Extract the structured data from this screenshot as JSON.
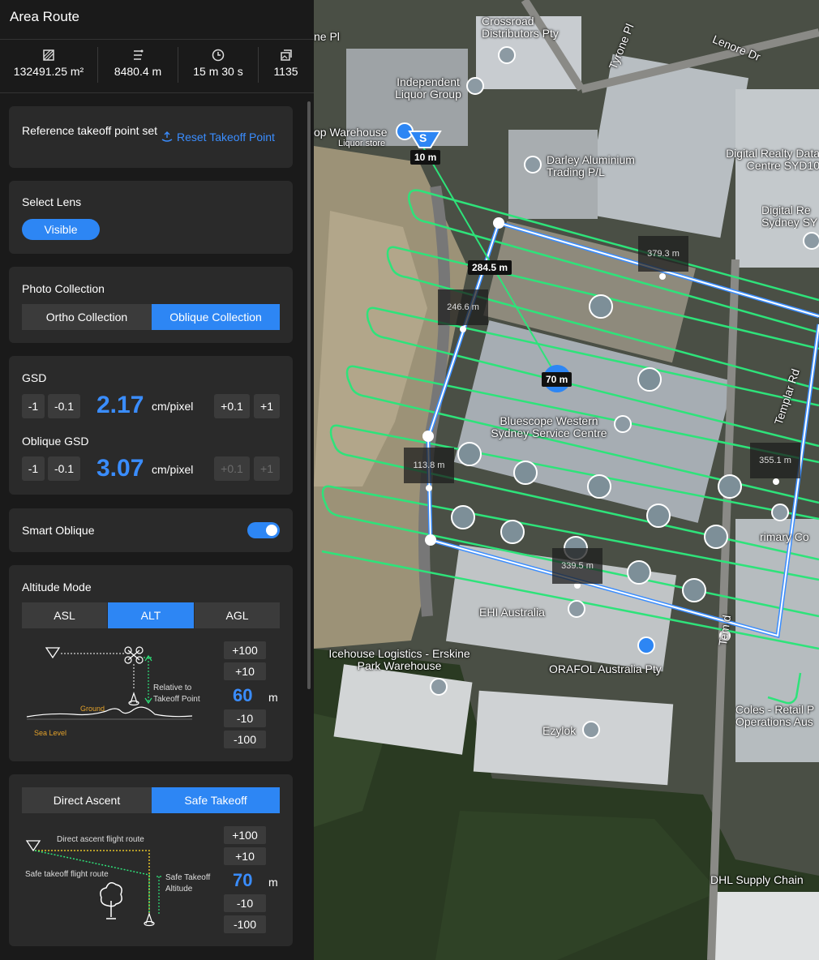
{
  "header": {
    "title": "Area Route"
  },
  "stats": [
    {
      "icon": "area-icon",
      "value": "132491.25 m²"
    },
    {
      "icon": "distance-icon",
      "value": "8480.4 m"
    },
    {
      "icon": "clock-icon",
      "value": "15 m 30 s"
    },
    {
      "icon": "photos-icon",
      "value": "1135"
    }
  ],
  "takeoff": {
    "label": "Reference takeoff point set",
    "reset_label": "Reset Takeoff Point"
  },
  "lens": {
    "label": "Select Lens",
    "selected": "Visible"
  },
  "photo": {
    "label": "Photo Collection",
    "ortho": "Ortho Collection",
    "oblique": "Oblique Collection",
    "selected": "Oblique Collection"
  },
  "gsd": {
    "label": "GSD",
    "value": "2.17",
    "unit": "cm/pixel",
    "minus1": "-1",
    "minus01": "-0.1",
    "plus01": "+0.1",
    "plus1": "+1",
    "oblique_label": "Oblique GSD",
    "oblique_value": "3.07"
  },
  "smart_oblique": {
    "label": "Smart Oblique",
    "enabled": true
  },
  "altitude": {
    "label": "Altitude Mode",
    "modes": [
      "ASL",
      "ALT",
      "AGL"
    ],
    "selected": "ALT",
    "value": "60",
    "unit": "m",
    "steps_up": [
      "+100",
      "+10"
    ],
    "steps_down": [
      "-10",
      "-100"
    ],
    "diagram": {
      "relative": "Relative to",
      "takeoff": "Takeoff Point",
      "ground": "Ground",
      "sea": "Sea Level"
    }
  },
  "takeoff_mode": {
    "options": [
      "Direct Ascent",
      "Safe Takeoff"
    ],
    "selected": "Safe Takeoff",
    "value": "70",
    "unit": "m",
    "steps_up": [
      "+100",
      "+10"
    ],
    "steps_down": [
      "-10",
      "-100"
    ],
    "diagram": {
      "direct": "Direct ascent flight route",
      "safe": "Safe takeoff flight route",
      "safe_alt_1": "Safe Takeoff",
      "safe_alt_2": "Altitude"
    }
  },
  "map": {
    "labels": [
      "Crossroad Distributors Pty",
      "Lenore Dr",
      "Tyrone Pl",
      "ne Pl",
      "Independent Liquor Group",
      "op Warehouse",
      "Liquor store",
      "Darley Aluminium Trading P/L",
      "Digital Realty Data Centre SYD10",
      "Digital Re Sydney SY",
      "Bluescope Western Sydney Service Centre",
      "Templar Rd",
      "rimary Co",
      "EHI Australia",
      "Icehouse Logistics - Erskine Park Warehouse",
      "ORAFOL Australia Pty",
      "Coles - Retail P Operations Aus",
      "Ezylok",
      "DHL Supply Chain",
      "Tem d"
    ],
    "distances": {
      "d10": "10 m",
      "d284": "284.5 m",
      "d246": "246.6 m",
      "d379": "379.3 m",
      "d70": "70 m",
      "d113": "113.8 m",
      "d355": "355.1 m",
      "d339": "339.5 m"
    },
    "takeoff_marker": "S",
    "colors": {
      "route": "#2ee37a",
      "boundary": "#ffffff",
      "accent": "#2d86f4"
    }
  }
}
